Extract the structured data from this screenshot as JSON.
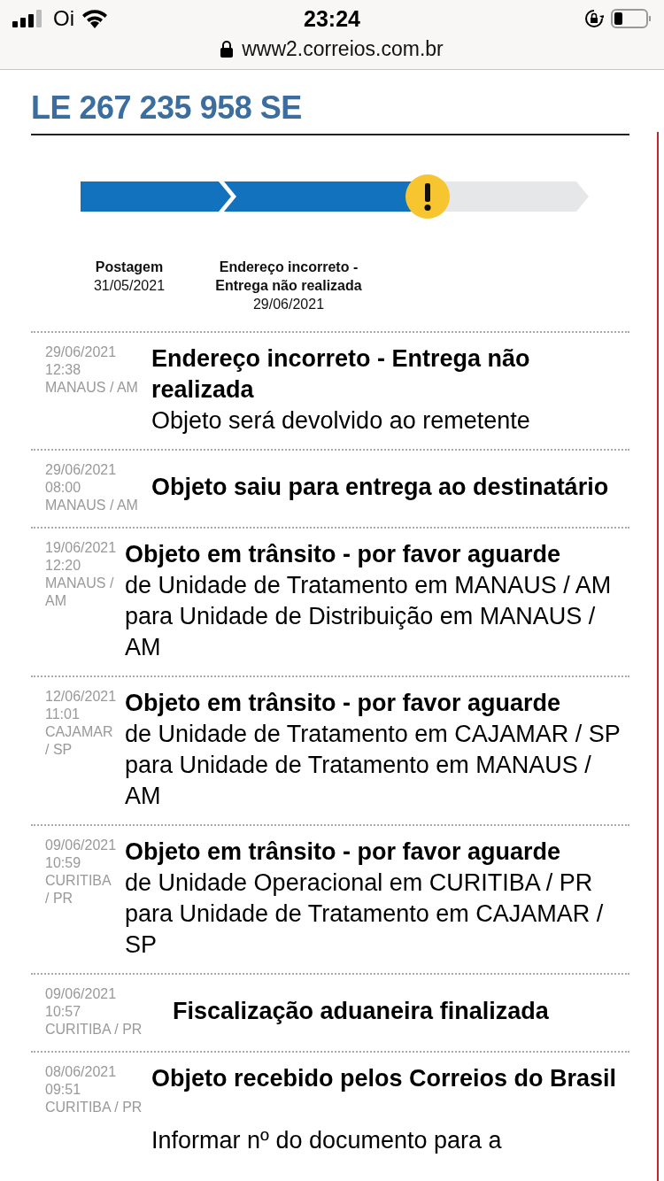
{
  "status_bar": {
    "carrier": "Oi",
    "time": "23:24"
  },
  "address_bar": {
    "url": "www2.correios.com.br"
  },
  "tracking_code": "LE 267 235 958 SE",
  "progress": {
    "segments": [
      {
        "done": true,
        "alert": false
      },
      {
        "done": true,
        "alert": true
      },
      {
        "done": false,
        "alert": false
      }
    ]
  },
  "milestones": [
    {
      "title": "Postagem",
      "date": "31/05/2021"
    },
    {
      "title": "Endereço incorreto - Entrega não realizada",
      "date": "29/06/2021"
    }
  ],
  "events": [
    {
      "date": "29/06/2021",
      "time": "12:38",
      "place": "MANAUS / AM",
      "title": "Endereço incorreto - Entrega não realizada",
      "detail": "Objeto será devolvido ao remetente"
    },
    {
      "date": "29/06/2021",
      "time": "08:00",
      "place": "MANAUS / AM",
      "title": "Objeto saiu para entrega ao destinatário"
    },
    {
      "date": "19/06/2021",
      "time": "12:20",
      "place": "MANAUS / AM",
      "title": "Objeto em trânsito - por favor aguarde",
      "detail": "de Unidade de Tratamento em MANAUS / AM para Unidade de Distribuição em MANAUS / AM"
    },
    {
      "date": "12/06/2021",
      "time": "11:01",
      "place": "CAJAMAR / SP",
      "title": "Objeto em trânsito - por favor aguarde",
      "detail": "de Unidade de Tratamento em CAJAMAR / SP para Unidade de Tratamento em MANAUS / AM"
    },
    {
      "date": "09/06/2021",
      "time": "10:59",
      "place": "CURITIBA / PR",
      "title": "Objeto em trânsito - por favor aguarde",
      "detail": "de Unidade Operacional em CURITIBA / PR para Unidade de Tratamento em CAJAMAR / SP"
    },
    {
      "date": "09/06/2021",
      "time": "10:57",
      "place": "CURITIBA / PR",
      "title": "Fiscalização aduaneira finalizada"
    },
    {
      "date": "08/06/2021",
      "time": "09:51",
      "place": "CURITIBA / PR",
      "title": "Objeto recebido pelos Correios do Brasil",
      "note": "Informar nº do documento para a"
    }
  ]
}
